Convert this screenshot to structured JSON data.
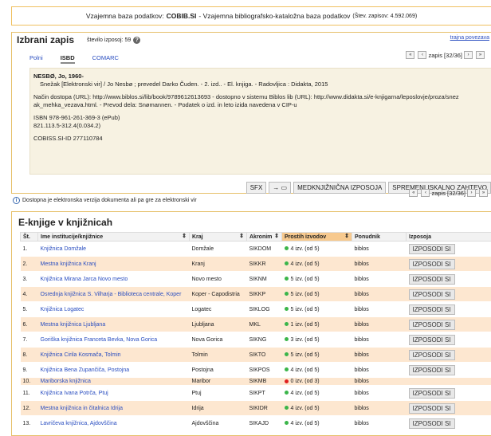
{
  "topbar": {
    "prefix": "Vzajemna baza podatkov:",
    "name": "COBIB.SI",
    "suffix": "- Vzajemna bibliografsko-kataložna baza podatkov",
    "count": "(Štev. zapisov: 4.592.069)"
  },
  "record_panel": {
    "title": "Izbrani zapis",
    "count_label": "število izposoj: 59",
    "link": "trajna povezava",
    "tabs": [
      "Polni",
      "ISBD",
      "COMARC"
    ],
    "active_tab": "ISBD",
    "record_nav": "zapis [32/36]",
    "author": "NESBØ, Jo, 1960-",
    "title_line": "Snežak [Elektronski vir] / Jo Nesbø ; prevedel Darko Čuden. - 2. izd.. - El. knjiga. - Radovljica : Didakta, 2015",
    "access_line": "Način dostopa (URL): http://www.biblos.si/lib/book/9789612613693 - dostopno v sistemu Biblos lib (URL): http://www.didakta.si/e-knjigarna/leposlovje/proza/snez ak_mehka_vezava.html. - Prevod dela: Snømannen. - Podatek o izd. in leto izida navedena v CIP-u",
    "isbn": "ISBN 978-961-261-369-3 (ePub)",
    "udk": "821.113.5-312.4(0.034.2)",
    "cobiss_id": "COBISS.SI-ID 277110784"
  },
  "actions": {
    "sfx": "SFX",
    "cart": "→ ▭",
    "ill": "MEDKNJIŽNIČNA IZPOSOJA",
    "modify": "SPREMENI ISKALNO ZAHTEVO"
  },
  "second_nav": "zapis [32/36]",
  "ebook_note": "Dostopna je elektronska verzija dokumenta ali pa gre za elektronski vir",
  "ebooks": {
    "title": "E-knjige v knjižnicah",
    "columns": [
      "Št.",
      "Ime institucije/knjižnice",
      "Kraj",
      "Akronim",
      "Prostih izvodov",
      "Ponudnik",
      "Izposoja"
    ],
    "borrow_label": "IZPOSODI SI",
    "rows": [
      {
        "n": "1.",
        "name": "Knjižnica Domžale",
        "place": "Domžale",
        "acr": "SIKDOM",
        "free": "4 izv. (od 5)",
        "status": "green",
        "provider": "biblos",
        "borrow": true
      },
      {
        "n": "2.",
        "name": "Mestna knjižnica Kranj",
        "place": "Kranj",
        "acr": "SIKKR",
        "free": "4 izv. (od 5)",
        "status": "green",
        "provider": "biblos",
        "borrow": true
      },
      {
        "n": "3.",
        "name": "Knjižnica Mirana Jarca Novo mesto",
        "place": "Novo mesto",
        "acr": "SIKNM",
        "free": "5 izv. (od 5)",
        "status": "green",
        "provider": "biblos",
        "borrow": true
      },
      {
        "n": "4.",
        "name": "Osrednja knjižnica S. Vilharja - Biblioteca centrale, Koper",
        "place": "Koper - Capodistria",
        "acr": "SIKKP",
        "free": "5 izv. (od 5)",
        "status": "green",
        "provider": "biblos",
        "borrow": true
      },
      {
        "n": "5.",
        "name": "Knjižnica Logatec",
        "place": "Logatec",
        "acr": "SIKLOG",
        "free": "5 izv. (od 5)",
        "status": "green",
        "provider": "biblos",
        "borrow": true
      },
      {
        "n": "6.",
        "name": "Mestna knjižnica Ljubljana",
        "place": "Ljubljana",
        "acr": "MKL",
        "free": "1 izv. (od 5)",
        "status": "green",
        "provider": "biblos",
        "borrow": true
      },
      {
        "n": "7.",
        "name": "Goriška knjižnica Franceta Bevka, Nova Gorica",
        "place": "Nova Gorica",
        "acr": "SIKNG",
        "free": "3 izv. (od 5)",
        "status": "green",
        "provider": "biblos",
        "borrow": true
      },
      {
        "n": "8.",
        "name": "Knjižnica Cirila Kosmača, Tolmin",
        "place": "Tolmin",
        "acr": "SIKTO",
        "free": "5 izv. (od 5)",
        "status": "green",
        "provider": "biblos",
        "borrow": true
      },
      {
        "n": "9.",
        "name": "Knjižnica Bena Zupančiča, Postojna",
        "place": "Postojna",
        "acr": "SIKPOS",
        "free": "4 izv. (od 5)",
        "status": "green",
        "provider": "biblos",
        "borrow": true
      },
      {
        "n": "10.",
        "name": "Mariborska knjižnica",
        "place": "Maribor",
        "acr": "SIKMB",
        "free": "0 izv. (od 3)",
        "status": "red",
        "provider": "biblos",
        "borrow": false
      },
      {
        "n": "11.",
        "name": "Knjižnica Ivana Potrča, Ptuj",
        "place": "Ptuj",
        "acr": "SIKPT",
        "free": "4 izv. (od 5)",
        "status": "green",
        "provider": "biblos",
        "borrow": true
      },
      {
        "n": "12.",
        "name": "Mestna knjižnica in čitalnica Idrija",
        "place": "Idrija",
        "acr": "SIKIDR",
        "free": "4 izv. (od 5)",
        "status": "green",
        "provider": "biblos",
        "borrow": true
      },
      {
        "n": "13.",
        "name": "Lavričeva knjižnica, Ajdovščina",
        "place": "Ajdovščina",
        "acr": "SIKAJD",
        "free": "4 izv. (od 5)",
        "status": "green",
        "provider": "biblos",
        "borrow": true
      }
    ]
  },
  "colors": {
    "panel_border": "#e6c06a",
    "row_stripe": "#fde7d0",
    "sort_header": "#f7c98e",
    "link": "#2a4ec0",
    "green": "#3bb54a",
    "red": "#e02020"
  }
}
